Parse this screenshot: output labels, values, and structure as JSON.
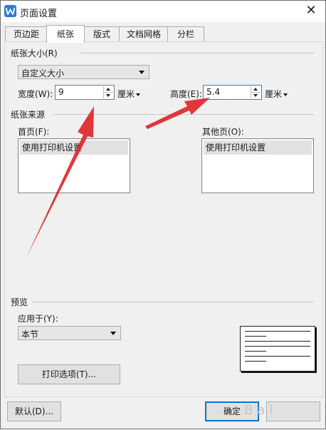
{
  "window": {
    "title": "页面设置",
    "close_glyph": "✕"
  },
  "tabs": [
    {
      "label": "页边距"
    },
    {
      "label": "纸张"
    },
    {
      "label": "版式"
    },
    {
      "label": "文档网格"
    },
    {
      "label": "分栏"
    }
  ],
  "active_tab": "纸张",
  "paper_size": {
    "group_label": "纸张大小(R)",
    "selected": "自定义大小",
    "width_label": "宽度(W):",
    "width_value": "9",
    "width_unit": "厘米",
    "height_label": "高度(E):",
    "height_value": "5.4",
    "height_unit": "厘米"
  },
  "paper_source": {
    "group_label": "纸张来源",
    "first_page_label": "首页(F):",
    "first_page_item": "使用打印机设置",
    "other_pages_label": "其他页(O):",
    "other_pages_item": "使用打印机设置"
  },
  "preview": {
    "group_label": "预览",
    "apply_to_label": "应用于(Y):",
    "apply_to_value": "本节",
    "print_options_button": "打印选项(T)..."
  },
  "footer": {
    "default_button": "默认(D)...",
    "ok_button": "确定",
    "watermark": "Bai"
  },
  "colors": {
    "arrow": "#e0262b",
    "accent": "#0078d7"
  },
  "icons": {
    "app": "wps-writer-icon",
    "close": "close-icon"
  }
}
